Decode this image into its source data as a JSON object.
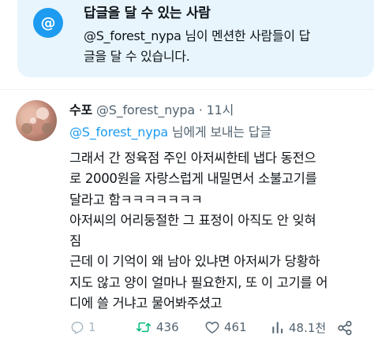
{
  "notice": {
    "icon": "at-icon",
    "icon_glyph": "@",
    "title": "답글을 달 수 있는 사람",
    "mention": "@S_forest_nypa",
    "line1_rest": " 님이 멘션한 사람들이 답",
    "line2": "글을 달 수 있습니다."
  },
  "tweet": {
    "name": "수포",
    "handle": "@S_forest_nypa",
    "separator": "·",
    "time": "11시",
    "reply_to_mention": "@S_forest_nypa",
    "reply_to_suffix": " 님에게 보내는 답글",
    "body_lines": [
      "그래서 간 정육점 주인 아저씨한테 냅다 동전으",
      "로 2000원을 자랑스럽게 내밀면서 소불고기를",
      "달라고 함ㅋㅋㅋㅋㅋㅋㅋ",
      "아저씨의 어리둥절한 그 표정이 아직도 안 잊혀",
      "짐",
      "근데 이 기억이 왜 남아 있냐면 아저씨가 당황하",
      "지도 않고 양이 얼마나 필요한지, 또 이 고기를 어",
      "디에 쓸 거냐고 물어봐주셨고"
    ]
  },
  "actions": {
    "reply_count": "1",
    "retweet_count": "436",
    "like_count": "461",
    "views_count": "48.1천"
  },
  "colors": {
    "accent": "#1d9bf0",
    "notice_bg": "#e8f5fd",
    "secondary_text": "#536471",
    "retweet_icon": "#00ba7c"
  }
}
